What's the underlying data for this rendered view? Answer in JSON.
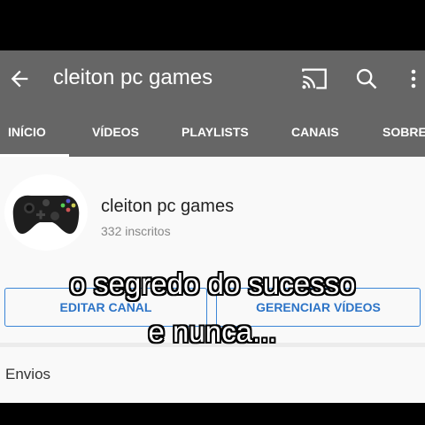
{
  "header": {
    "title": "cleiton pc games",
    "icons": [
      "back-arrow-icon",
      "cast-icon",
      "search-icon",
      "more-vert-icon"
    ]
  },
  "tabs": [
    {
      "label": "INÍCIO",
      "active": true
    },
    {
      "label": "VÍDEOS"
    },
    {
      "label": "PLAYLISTS"
    },
    {
      "label": "CANAIS"
    },
    {
      "label": "SOBRE"
    }
  ],
  "channel": {
    "name": "cleiton pc games",
    "subscribers": "332 inscritos",
    "avatar_icon": "game-controller-icon"
  },
  "buttons": {
    "edit": "EDITAR CANAL",
    "manage": "GERENCIAR VÍDEOS"
  },
  "section": {
    "uploads": "Envios"
  },
  "caption": {
    "line1": "o segredo do sucesso",
    "line2": "e nunca..."
  },
  "colors": {
    "appbar": "#666666",
    "accent": "#2d74c7",
    "background": "#f9f9f9"
  }
}
